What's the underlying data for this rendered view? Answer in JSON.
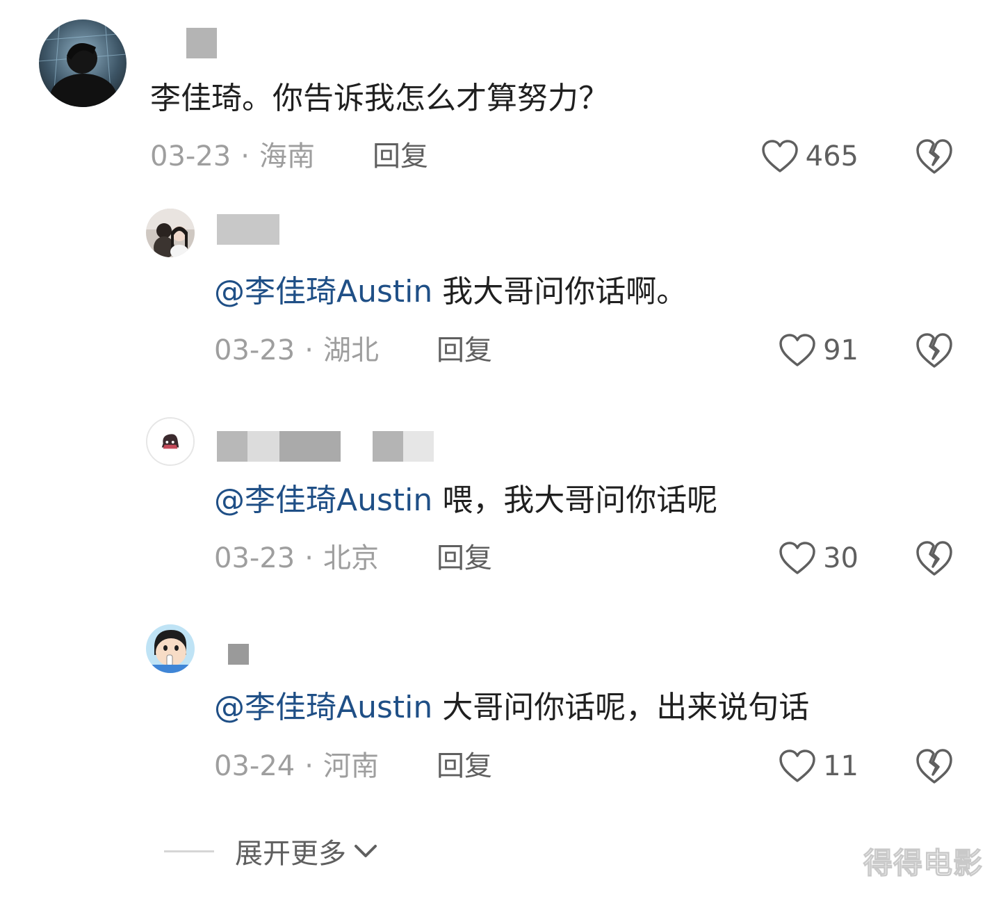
{
  "comments": [
    {
      "text": "李佳琦。你告诉我怎么才算努力？",
      "date": "03-23",
      "separator": "·",
      "location": "海南",
      "reply_label": "回复",
      "likes": "465"
    },
    {
      "mention": "@李佳琦Austin",
      "text": " 我大哥问你话啊。",
      "date": "03-23",
      "separator": "·",
      "location": "湖北",
      "reply_label": "回复",
      "likes": "91"
    },
    {
      "mention": "@李佳琦Austin",
      "text": " 喂，我大哥问你话呢",
      "date": "03-23",
      "separator": "·",
      "location": "北京",
      "reply_label": "回复",
      "likes": "30"
    },
    {
      "mention": "@李佳琦Austin",
      "text": " 大哥问你话呢，出来说句话",
      "date": "03-24",
      "separator": "·",
      "location": "河南",
      "reply_label": "回复",
      "likes": "11"
    }
  ],
  "expand_label": "展开更多",
  "watermark": "得得电影",
  "colors": {
    "mention": "#1f4f86",
    "meta": "#9e9e9e",
    "action": "#5f5f5f"
  }
}
